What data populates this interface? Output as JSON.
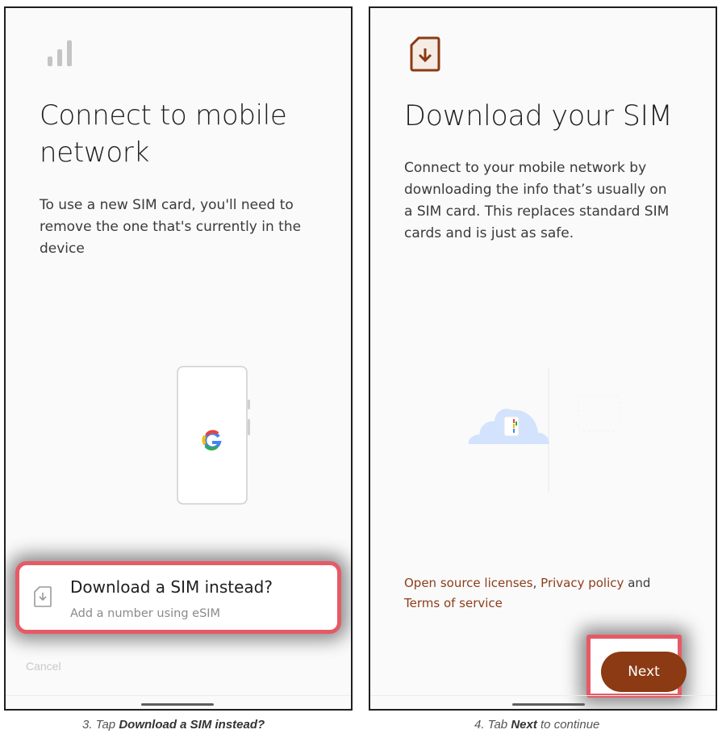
{
  "left_screen": {
    "title": "Connect to mobile network",
    "description": "To use a new SIM card, you'll need to remove the one that's currently in the device",
    "download_option": {
      "title": "Download a SIM instead?",
      "subtitle": "Add a number using eSIM"
    },
    "cancel_label": "Cancel"
  },
  "right_screen": {
    "title": "Download your SIM",
    "description": "Connect to your mobile network by downloading the info that’s usually on a SIM card. This replaces standard SIM cards and is just as safe.",
    "links": {
      "open_source": "Open source licenses",
      "separator": ",",
      "privacy": "Privacy policy",
      "and": "and",
      "terms": "Terms of service"
    },
    "next_label": "Next"
  },
  "captions": {
    "left_prefix": "3. Tap ",
    "left_bold": "Download a SIM instead?",
    "right_prefix": "4. Tab ",
    "right_bold": "Next",
    "right_suffix": " to continue"
  },
  "icons": {
    "signal": "signal-bars-icon",
    "sim_download": "sim-download-icon"
  },
  "colors": {
    "accent": "#8b3a13",
    "highlight": "#e65a66",
    "link": "#8c3d1c"
  }
}
